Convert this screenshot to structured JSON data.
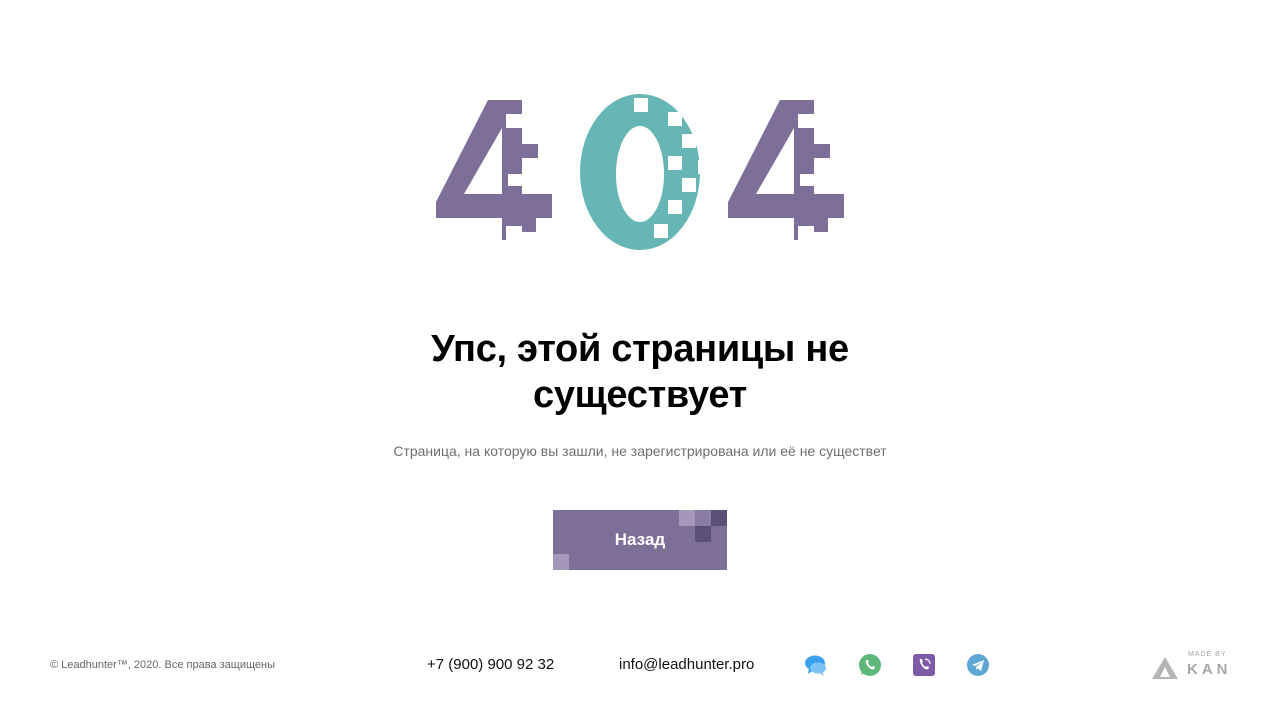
{
  "theme": {
    "accent": "#7d6f98",
    "teal": "#66b6b6",
    "text": "#000000",
    "muted": "#6f6f6f"
  },
  "hero": {
    "code": "404"
  },
  "main": {
    "title_line1": "Упс, этой страницы не",
    "title_line2": "существует",
    "subtitle": "Страница, на которую вы зашли, не зарегистрирована или её не существет",
    "back_button_label": "Назад"
  },
  "footer": {
    "copyright": "© Leadhunter™, 2020. Все права защищены",
    "phone": "+7 (900) 900 92 32",
    "email": "info@leadhunter.pro",
    "socials": [
      {
        "icon": "chat-bubbles-icon",
        "color": "#3aa0f0"
      },
      {
        "icon": "whatsapp-icon",
        "color": "#5fb87a"
      },
      {
        "icon": "viber-icon",
        "color": "#7d5ba6"
      },
      {
        "icon": "telegram-icon",
        "color": "#5ea6d6"
      }
    ],
    "made_by_small": "MADE BY",
    "made_by_brand": "KAN"
  }
}
